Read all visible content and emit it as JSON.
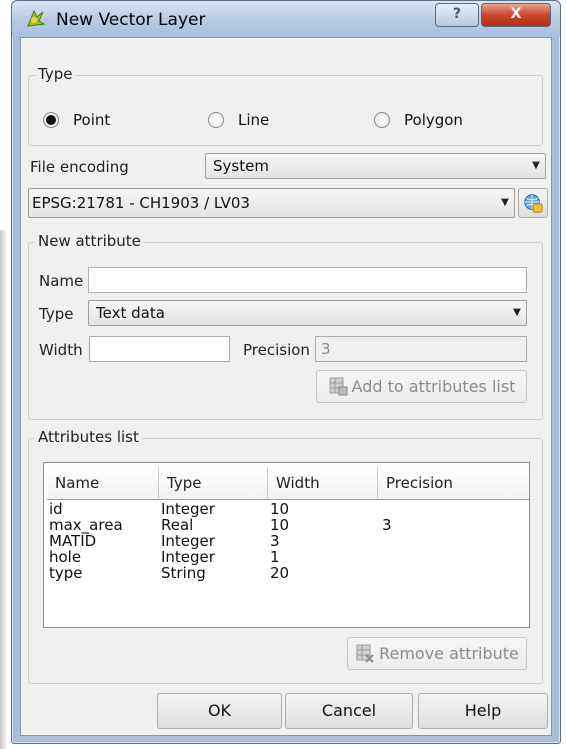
{
  "window": {
    "title": "New Vector Layer",
    "help_glyph": "?",
    "close_glyph": "X"
  },
  "type_group": {
    "legend": "Type",
    "options": [
      {
        "label": "Point",
        "checked": true
      },
      {
        "label": "Line",
        "checked": false
      },
      {
        "label": "Polygon",
        "checked": false
      }
    ]
  },
  "file_encoding": {
    "label": "File encoding",
    "value": "System"
  },
  "crs": {
    "value": "EPSG:21781 - CH1903 / LV03"
  },
  "new_attribute": {
    "legend": "New attribute",
    "name_label": "Name",
    "name_value": "",
    "type_label": "Type",
    "type_value": "Text data",
    "width_label": "Width",
    "width_value": "",
    "precision_label": "Precision",
    "precision_value": "3",
    "add_button": "Add to attributes list"
  },
  "attributes_list": {
    "legend": "Attributes list",
    "columns": [
      "Name",
      "Type",
      "Width",
      "Precision"
    ],
    "rows": [
      [
        "id",
        "Integer",
        "10",
        ""
      ],
      [
        "max_area",
        "Real",
        "10",
        "3"
      ],
      [
        "MATID",
        "Integer",
        "3",
        ""
      ],
      [
        "hole",
        "Integer",
        "1",
        ""
      ],
      [
        "type",
        "String",
        "20",
        ""
      ]
    ],
    "remove_button": "Remove attribute"
  },
  "buttons": {
    "ok": "OK",
    "cancel": "Cancel",
    "help": "Help"
  },
  "icons": {
    "app": "qgis-logo-icon",
    "crs": "globe-projection-icon"
  },
  "colors": {
    "title_bar": "#b8cce3",
    "close": "#c8482c",
    "dialog_bg": "#f0f0f0"
  }
}
